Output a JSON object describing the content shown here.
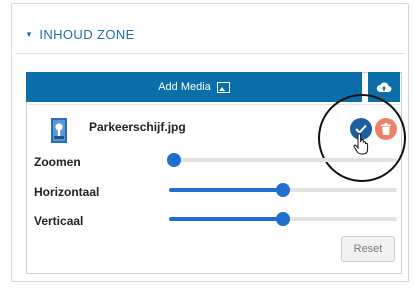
{
  "zone": {
    "title": "INHOUD ZONE"
  },
  "media": {
    "add_label": "Add Media"
  },
  "item": {
    "filename": "Parkeerschijf.jpg"
  },
  "controls": [
    {
      "label": "Zoomen",
      "value_fraction": 0.02
    },
    {
      "label": "Horizontaal",
      "value_fraction": 0.5
    },
    {
      "label": "Verticaal",
      "value_fraction": 0.5
    }
  ],
  "reset_label": "Reset",
  "icons": {
    "collapse": "caret-down-icon",
    "add_media": "image-icon",
    "upload": "cloud-upload-icon",
    "file": "file-thumbnail-icon",
    "confirm": "check-icon",
    "delete": "trash-icon",
    "pointer": "hand-cursor-icon"
  },
  "colors": {
    "accent": "#0b6ea8",
    "confirm": "#1c5fa0",
    "delete": "#f07f68",
    "slider": "#1f6fd1"
  }
}
